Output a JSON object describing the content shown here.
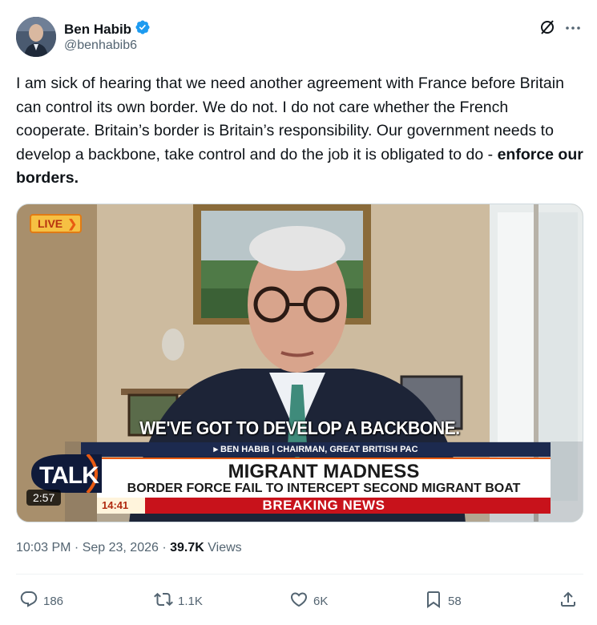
{
  "author": {
    "display_name": "Ben Habib",
    "handle": "@benhabib6",
    "verified": true
  },
  "tweet": {
    "text_main": "I am sick of hearing that we need another agreement with France before Britain can control its own border. We do not. I do not care whether the French cooperate. Britain’s border is Britain’s responsibility. Our government needs to develop a backbone, take control and do the job it is obligated to do - ",
    "text_bold": "enforce our borders."
  },
  "media": {
    "live_label": "LIVE",
    "subtitle": "WE'VE GOT TO DEVELOP A BACKBONE.",
    "caption": "▸ BEN HABIB | CHAIRMAN, GREAT BRITISH PAC",
    "headline": "MIGRANT MADNESS",
    "subheadline": "BORDER FORCE FAIL TO INTERCEPT SECOND MIGRANT BOAT",
    "breaking": "BREAKING NEWS",
    "broadcast_time": "14:41",
    "channel_logo": "TALK",
    "duration": "2:57"
  },
  "meta": {
    "timestamp": "10:03 PM · Sep 23, 2026 · ",
    "views_count": "39.7K",
    "views_label": " Views"
  },
  "actions": {
    "replies": "186",
    "reposts": "1.1K",
    "likes": "6K",
    "bookmarks": "58"
  },
  "icons": {
    "verified": "verified-badge-icon",
    "grok": "grok-icon",
    "more": "more-icon",
    "reply": "reply-icon",
    "repost": "repost-icon",
    "like": "like-icon",
    "bookmark": "bookmark-icon",
    "share": "share-icon"
  },
  "colors": {
    "verified_blue": "#1d9bf0",
    "secondary_text": "#536471",
    "breaking_red": "#c8121b"
  }
}
